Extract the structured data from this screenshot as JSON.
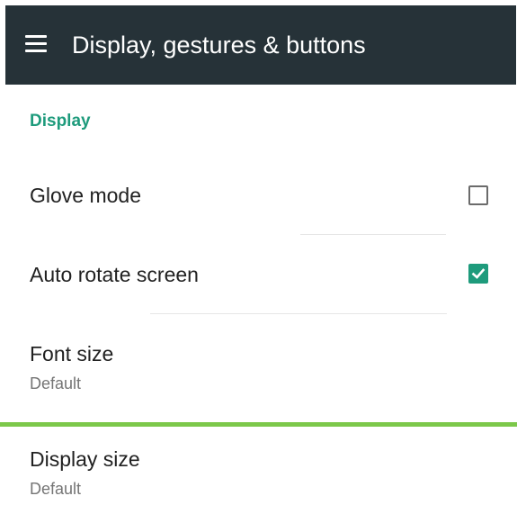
{
  "toolbar": {
    "title": "Display, gestures & buttons",
    "menu_icon": "hamburger-menu-icon",
    "background_color": "#263238"
  },
  "section": {
    "header": "Display",
    "accent_color": "#1e9b7c"
  },
  "settings": [
    {
      "title": "Glove mode",
      "checked": false
    },
    {
      "title": "Auto rotate screen",
      "checked": true
    },
    {
      "title": "Font size",
      "summary": "Default"
    },
    {
      "title": "Display size",
      "summary": "Default"
    }
  ],
  "highlight_color": "#7cc84a"
}
